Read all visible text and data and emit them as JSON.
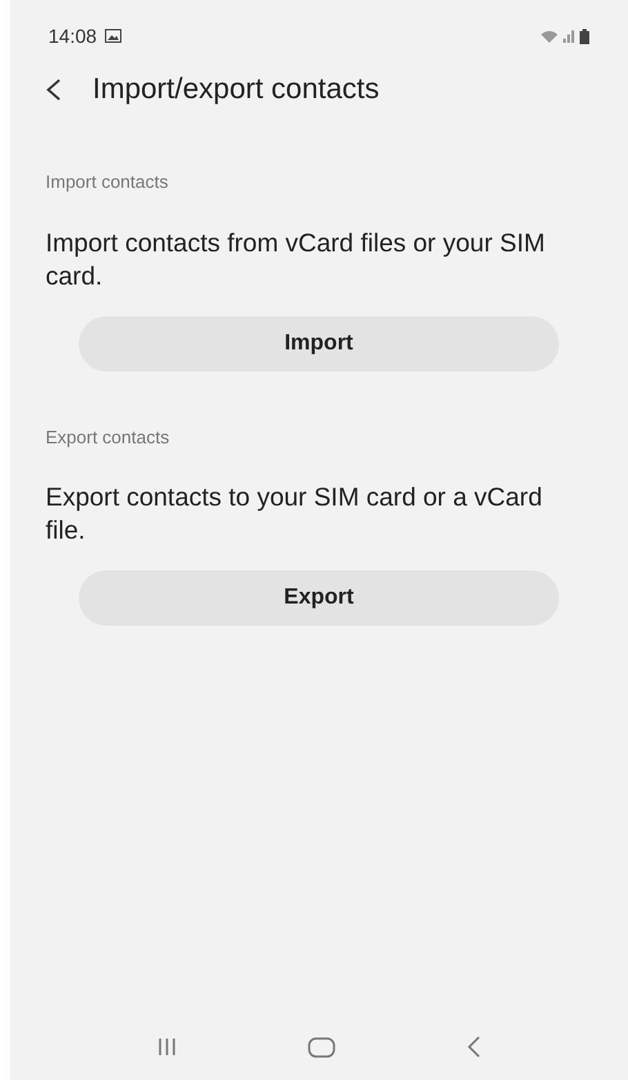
{
  "status_bar": {
    "time": "14:08"
  },
  "header": {
    "title": "Import/export contacts"
  },
  "sections": [
    {
      "heading": "Import contacts",
      "description": "Import contacts from vCard files or your SIM card.",
      "button": "Import"
    },
    {
      "heading": "Export contacts",
      "description": "Export contacts to your SIM card or a vCard file.",
      "button": "Export"
    }
  ]
}
